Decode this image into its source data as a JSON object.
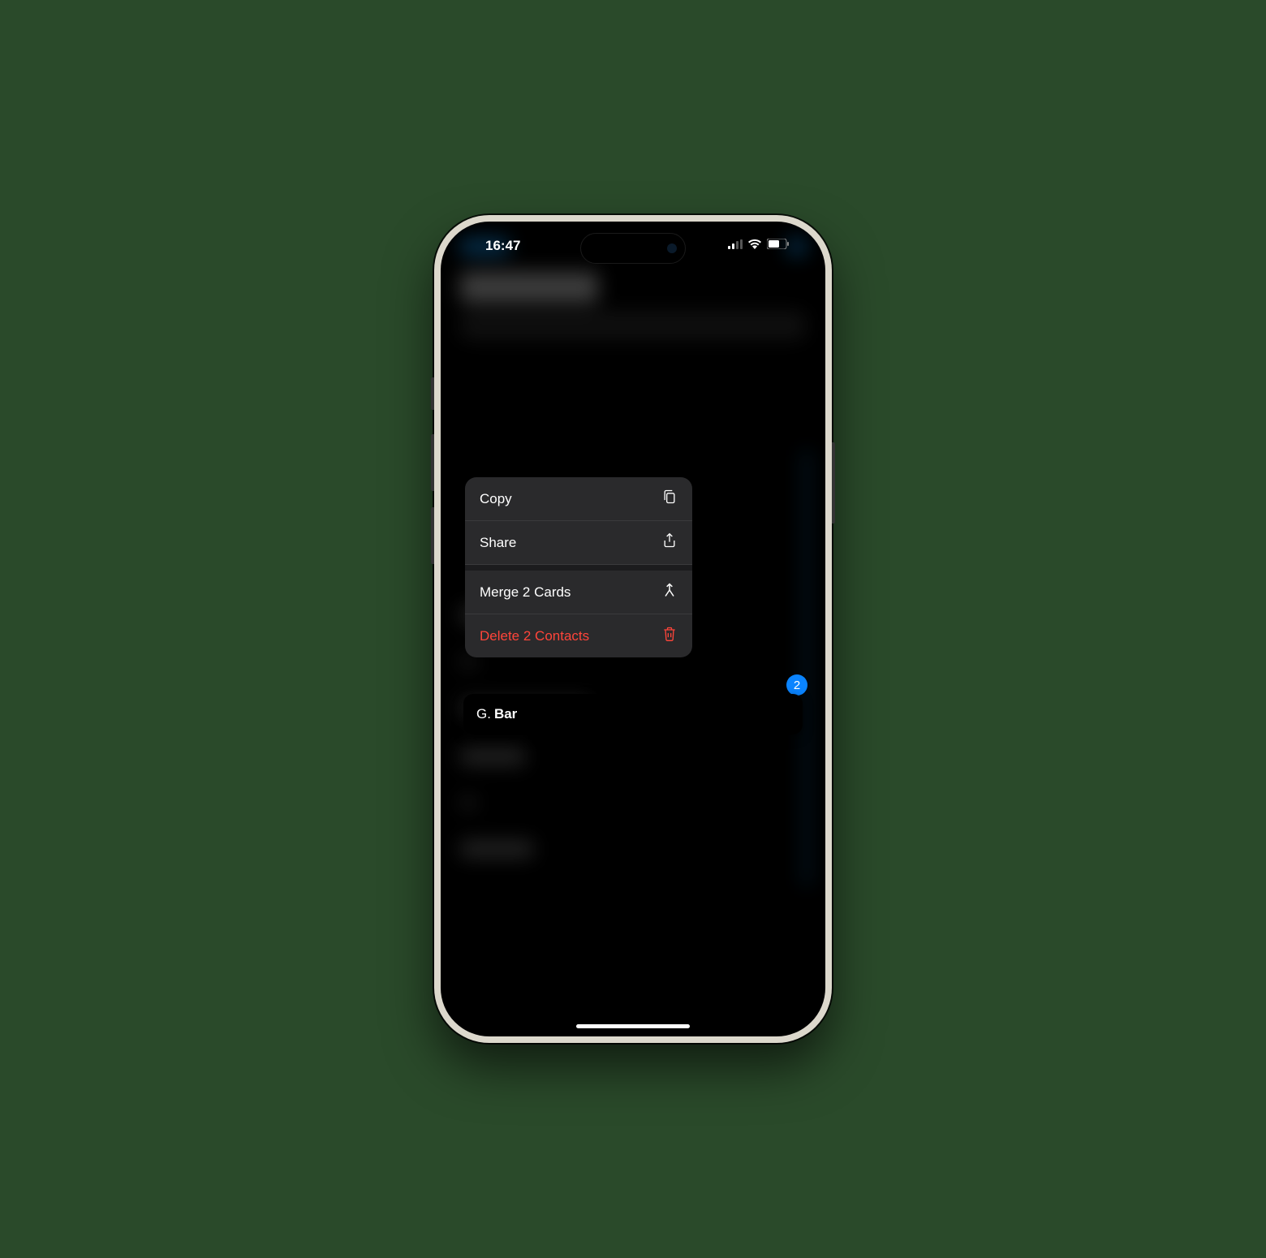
{
  "status_bar": {
    "time": "16:47"
  },
  "context_menu": {
    "copy": "Copy",
    "share": "Share",
    "merge": "Merge 2 Cards",
    "delete": "Delete 2 Contacts"
  },
  "selection": {
    "count": "2"
  },
  "contact": {
    "prefix": "G.",
    "name": "Bar"
  }
}
